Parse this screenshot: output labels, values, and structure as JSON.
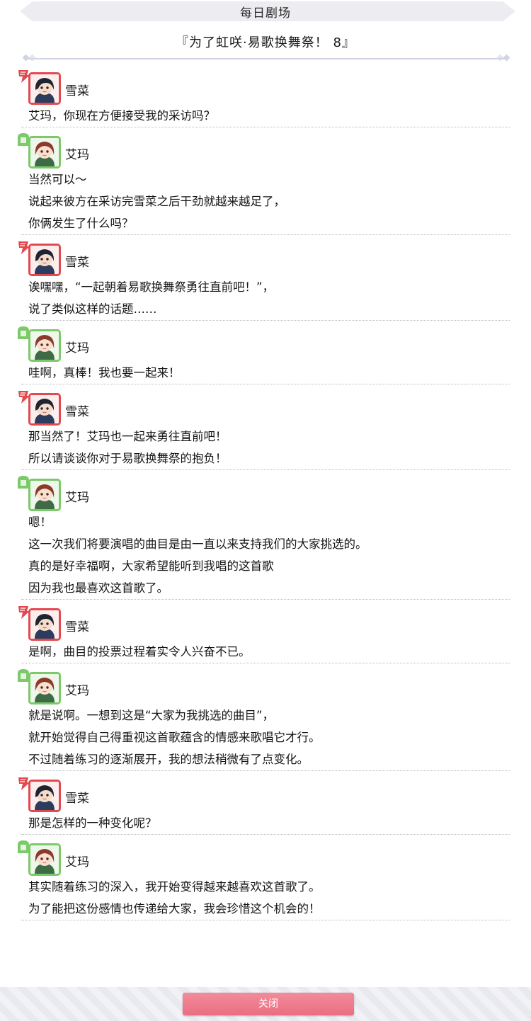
{
  "header": {
    "title": "每日剧场"
  },
  "story": {
    "title": "『为了虹咲·易歌换舞祭！ 8』"
  },
  "colors": {
    "setsuna_accent": "#e2494f",
    "emma_accent": "#7cc96a",
    "close_button": "#ea6e82"
  },
  "dialogue": [
    {
      "speaker": "雪菜",
      "character": "setsuna",
      "lines": [
        "艾玛，你现在方便接受我的采访吗？"
      ]
    },
    {
      "speaker": "艾玛",
      "character": "emma",
      "lines": [
        "当然可以～",
        "说起来彼方在采访完雪菜之后干劲就越来越足了，",
        "你俩发生了什么吗？"
      ]
    },
    {
      "speaker": "雪菜",
      "character": "setsuna",
      "lines": [
        "诶嘿嘿，“一起朝着易歌换舞祭勇往直前吧！”，",
        "说了类似这样的话题……"
      ]
    },
    {
      "speaker": "艾玛",
      "character": "emma",
      "lines": [
        "哇啊，真棒！我也要一起来！"
      ]
    },
    {
      "speaker": "雪菜",
      "character": "setsuna",
      "lines": [
        "那当然了！艾玛也一起来勇往直前吧！",
        "所以请谈谈你对于易歌换舞祭的抱负！"
      ]
    },
    {
      "speaker": "艾玛",
      "character": "emma",
      "lines": [
        "嗯！",
        "这一次我们将要演唱的曲目是由一直以来支持我们的大家挑选的。",
        "真的是好幸福啊，大家希望能听到我唱的这首歌",
        "因为我也最喜欢这首歌了。"
      ]
    },
    {
      "speaker": "雪菜",
      "character": "setsuna",
      "lines": [
        "是啊，曲目的投票过程着实令人兴奋不已。"
      ]
    },
    {
      "speaker": "艾玛",
      "character": "emma",
      "lines": [
        "就是说啊。一想到这是“大家为我挑选的曲目”，",
        "就开始觉得自己得重视这首歌蕴含的情感来歌唱它才行。",
        "不过随着练习的逐渐展开，我的想法稍微有了点变化。"
      ]
    },
    {
      "speaker": "雪菜",
      "character": "setsuna",
      "lines": [
        "那是怎样的一种变化呢？"
      ]
    },
    {
      "speaker": "艾玛",
      "character": "emma",
      "lines": [
        "其实随着练习的深入，我开始变得越来越喜欢这首歌了。",
        "为了能把这份感情也传递给大家，我会珍惜这个机会的！"
      ]
    }
  ],
  "footer": {
    "close_label": "关闭"
  }
}
